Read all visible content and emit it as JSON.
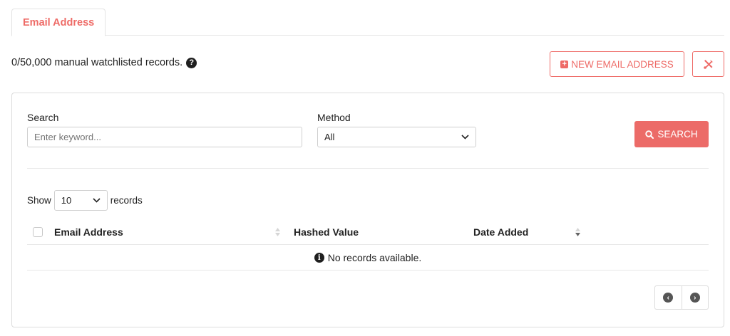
{
  "tabs": [
    {
      "label": "Email Address",
      "active": true
    }
  ],
  "summary": {
    "text": "0/50,000 manual watchlisted records.",
    "help_icon": "question-circle-icon"
  },
  "toolbar": {
    "new_button_label": "NEW EMAIL ADDRESS",
    "new_button_icon": "plus-square-icon",
    "tools_icon": "tools-icon"
  },
  "filters": {
    "search": {
      "label": "Search",
      "placeholder": "Enter keyword...",
      "value": ""
    },
    "method": {
      "label": "Method",
      "selected": "All"
    },
    "search_button_label": "SEARCH"
  },
  "table": {
    "show_label": "Show",
    "page_size": "10",
    "records_label": "records",
    "columns": [
      "Email Address",
      "Hashed Value",
      "Date Added"
    ],
    "empty_message": "No records available."
  },
  "colors": {
    "accent": "#ee6b67",
    "search_button": "#ec6b68"
  }
}
